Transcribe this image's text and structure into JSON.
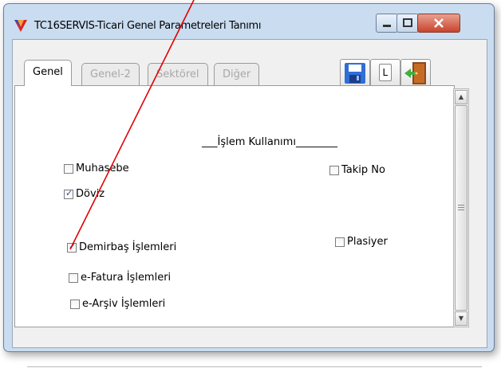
{
  "window": {
    "title": "TC16SERVIS-Ticari Genel Parametreleri Tanımı"
  },
  "toolbar": {
    "save_icon": "floppy-save-icon",
    "l_label": "L",
    "exit_icon": "door-exit-icon"
  },
  "tabs": [
    {
      "label": "Genel",
      "active": true
    },
    {
      "label": "Genel-2",
      "active": false
    },
    {
      "label": "Sektörel",
      "active": false
    },
    {
      "label": "Diğer",
      "active": false
    }
  ],
  "panel": {
    "section_title": "___İşlem Kullanımı________",
    "checkboxes": [
      {
        "label": "Muhasebe",
        "checked": false
      },
      {
        "label": "Döviz",
        "checked": true
      },
      {
        "label": "Demirbaş İşlemleri",
        "checked": true
      },
      {
        "label": "e-Fatura İşlemleri",
        "checked": false
      },
      {
        "label": "e-Arşiv İşlemleri",
        "checked": false
      },
      {
        "label": "Takip No",
        "checked": false
      },
      {
        "label": "Plasiyer",
        "checked": false
      }
    ]
  },
  "colors": {
    "annotation_line": "#e00000",
    "frame": "#c9dcf0"
  }
}
